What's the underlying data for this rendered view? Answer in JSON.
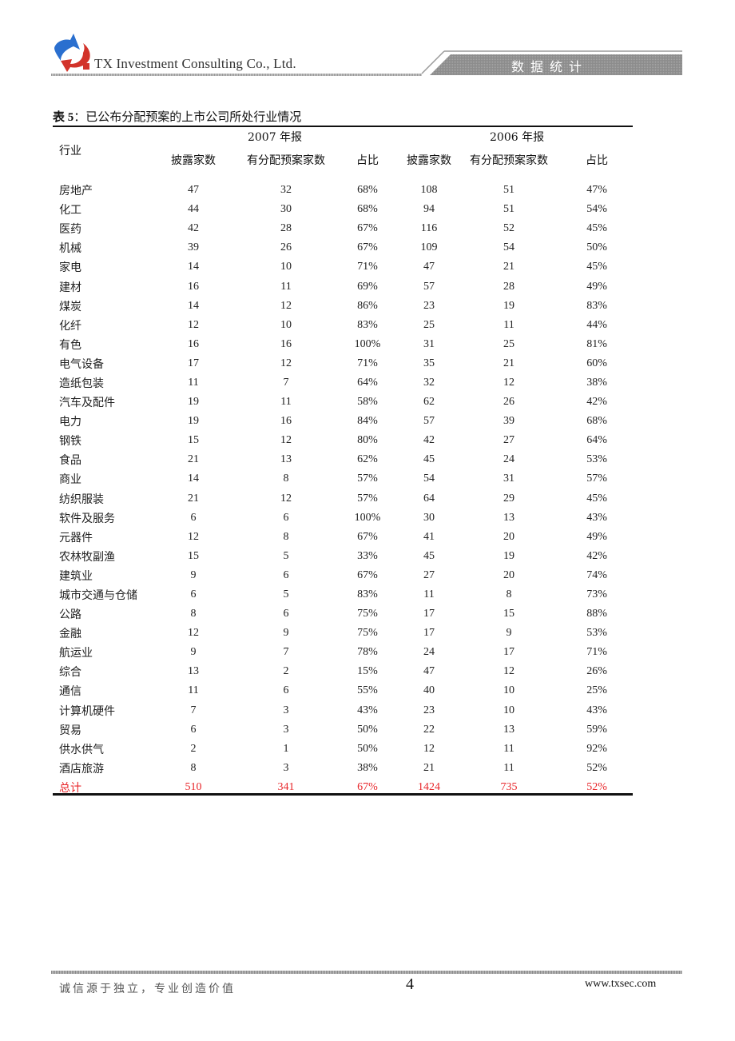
{
  "header": {
    "company": "TX Investment Consulting Co., Ltd.",
    "section_title": "数据统计",
    "colors": {
      "logo_blue": "#2a6fcf",
      "logo_red": "#d2332a",
      "banner_gray": "#8c8c8c"
    }
  },
  "table": {
    "title_prefix": "表 5",
    "title_sep": "：",
    "title_text": "已公布分配预案的上市公司所处行业情况",
    "industry_header": "行业",
    "groups": [
      "2007 年报",
      "2006 年报"
    ],
    "sub_headers": [
      "披露家数",
      "有分配预案家数",
      "占比",
      "披露家数",
      "有分配预案家数",
      "占比"
    ],
    "rows": [
      [
        "房地产",
        "47",
        "32",
        "68%",
        "108",
        "51",
        "47%"
      ],
      [
        "化工",
        "44",
        "30",
        "68%",
        "94",
        "51",
        "54%"
      ],
      [
        "医药",
        "42",
        "28",
        "67%",
        "116",
        "52",
        "45%"
      ],
      [
        "机械",
        "39",
        "26",
        "67%",
        "109",
        "54",
        "50%"
      ],
      [
        "家电",
        "14",
        "10",
        "71%",
        "47",
        "21",
        "45%"
      ],
      [
        "建材",
        "16",
        "11",
        "69%",
        "57",
        "28",
        "49%"
      ],
      [
        "煤炭",
        "14",
        "12",
        "86%",
        "23",
        "19",
        "83%"
      ],
      [
        "化纤",
        "12",
        "10",
        "83%",
        "25",
        "11",
        "44%"
      ],
      [
        "有色",
        "16",
        "16",
        "100%",
        "31",
        "25",
        "81%"
      ],
      [
        "电气设备",
        "17",
        "12",
        "71%",
        "35",
        "21",
        "60%"
      ],
      [
        "造纸包装",
        "11",
        "7",
        "64%",
        "32",
        "12",
        "38%"
      ],
      [
        "汽车及配件",
        "19",
        "11",
        "58%",
        "62",
        "26",
        "42%"
      ],
      [
        "电力",
        "19",
        "16",
        "84%",
        "57",
        "39",
        "68%"
      ],
      [
        "钢铁",
        "15",
        "12",
        "80%",
        "42",
        "27",
        "64%"
      ],
      [
        "食品",
        "21",
        "13",
        "62%",
        "45",
        "24",
        "53%"
      ],
      [
        "商业",
        "14",
        "8",
        "57%",
        "54",
        "31",
        "57%"
      ],
      [
        "纺织服装",
        "21",
        "12",
        "57%",
        "64",
        "29",
        "45%"
      ],
      [
        "软件及服务",
        "6",
        "6",
        "100%",
        "30",
        "13",
        "43%"
      ],
      [
        "元器件",
        "12",
        "8",
        "67%",
        "41",
        "20",
        "49%"
      ],
      [
        "农林牧副渔",
        "15",
        "5",
        "33%",
        "45",
        "19",
        "42%"
      ],
      [
        "建筑业",
        "9",
        "6",
        "67%",
        "27",
        "20",
        "74%"
      ],
      [
        "城市交通与仓储",
        "6",
        "5",
        "83%",
        "11",
        "8",
        "73%"
      ],
      [
        "公路",
        "8",
        "6",
        "75%",
        "17",
        "15",
        "88%"
      ],
      [
        "金融",
        "12",
        "9",
        "75%",
        "17",
        "9",
        "53%"
      ],
      [
        "航运业",
        "9",
        "7",
        "78%",
        "24",
        "17",
        "71%"
      ],
      [
        "综合",
        "13",
        "2",
        "15%",
        "47",
        "12",
        "26%"
      ],
      [
        "通信",
        "11",
        "6",
        "55%",
        "40",
        "10",
        "25%"
      ],
      [
        "计算机硬件",
        "7",
        "3",
        "43%",
        "23",
        "10",
        "43%"
      ],
      [
        "贸易",
        "6",
        "3",
        "50%",
        "22",
        "13",
        "59%"
      ],
      [
        "供水供气",
        "2",
        "1",
        "50%",
        "12",
        "11",
        "92%"
      ],
      [
        "酒店旅游",
        "8",
        "3",
        "38%",
        "21",
        "11",
        "52%"
      ]
    ],
    "total": [
      "总计",
      "510",
      "341",
      "67%",
      "1424",
      "735",
      "52%"
    ],
    "total_color": "#e8262a"
  },
  "footer": {
    "slogan": "诚信源于独立，专业创造价值",
    "page_number": "4",
    "website": "www.txsec.com"
  }
}
